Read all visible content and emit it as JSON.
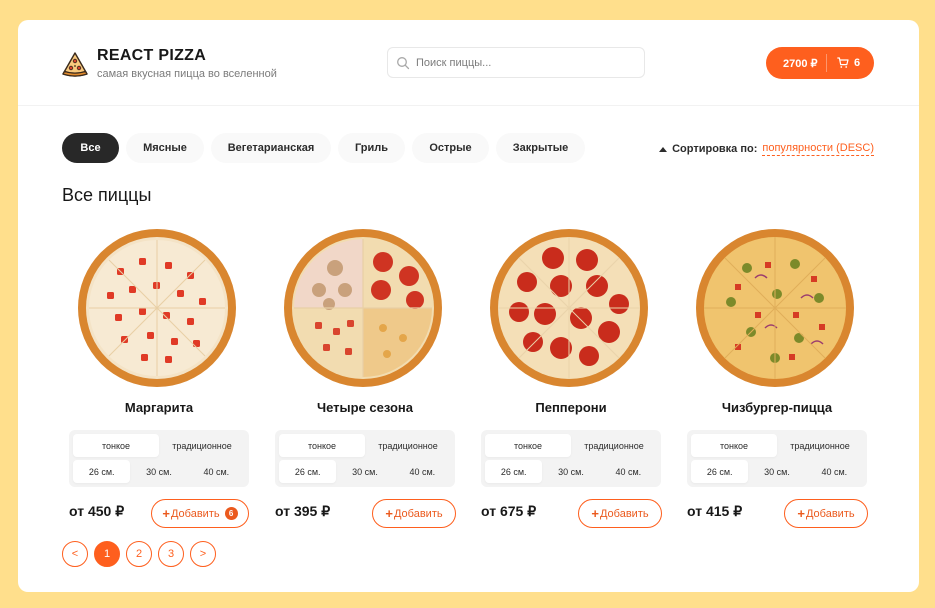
{
  "header": {
    "title": "REACT PIZZA",
    "subtitle": "самая вкусная пицца во вселенной",
    "search_placeholder": "Поиск пиццы...",
    "cart_total": "2700 ₽",
    "cart_count": "6"
  },
  "categories": [
    "Все",
    "Мясные",
    "Вегетарианская",
    "Гриль",
    "Острые",
    "Закрытые"
  ],
  "active_category": "Все",
  "sort": {
    "label": "Сортировка по:",
    "value": "популярности (DESC)"
  },
  "content_title": "Все пиццы",
  "pizzas": [
    {
      "name": "Маргарита",
      "types": [
        "тонкое",
        "традиционное"
      ],
      "sizes": [
        "26 см.",
        "30 см.",
        "40 см."
      ],
      "price": "от 450 ₽",
      "add_label": "Добавить",
      "count": "6"
    },
    {
      "name": "Четыре сезона",
      "types": [
        "тонкое",
        "традиционное"
      ],
      "sizes": [
        "26 см.",
        "30 см.",
        "40 см."
      ],
      "price": "от 395 ₽",
      "add_label": "Добавить",
      "count": ""
    },
    {
      "name": "Пепперони",
      "types": [
        "тонкое",
        "традиционное"
      ],
      "sizes": [
        "26 см.",
        "30 см.",
        "40 см."
      ],
      "price": "от 675 ₽",
      "add_label": "Добавить",
      "count": ""
    },
    {
      "name": "Чизбургер-пицца",
      "types": [
        "тонкое",
        "традиционное"
      ],
      "sizes": [
        "26 см.",
        "30 см.",
        "40 см."
      ],
      "price": "от 415 ₽",
      "add_label": "Добавить",
      "count": ""
    }
  ],
  "pagination": {
    "prev": "<",
    "pages": [
      "1",
      "2",
      "3"
    ],
    "next": ">",
    "active": "1"
  },
  "colors": {
    "accent": "#fe5f1e",
    "background": "#ffdf8c",
    "dark": "#282828"
  },
  "icons": {
    "logo": "pizza-slice-icon",
    "search": "search-icon",
    "cart": "cart-icon"
  }
}
